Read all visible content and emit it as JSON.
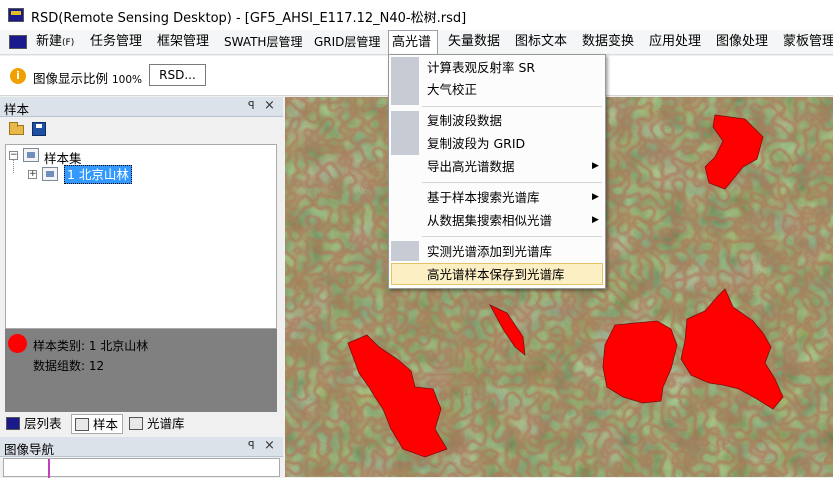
{
  "window": {
    "title": "RSD(Remote Sensing Desktop) - [GF5_AHSI_E117.12_N40-松树.rsd]"
  },
  "menubar": {
    "items": [
      {
        "label": "新建",
        "sub": "(F)"
      },
      {
        "label": "任务管理"
      },
      {
        "label": "框架管理"
      },
      {
        "label": "SWATH层管理"
      },
      {
        "label": "GRID层管理"
      },
      {
        "label": "高光谱"
      },
      {
        "label": "矢量数据"
      },
      {
        "label": "图标文本"
      },
      {
        "label": "数据变换"
      },
      {
        "label": "应用处理"
      },
      {
        "label": "图像处理"
      },
      {
        "label": "蒙板管理"
      }
    ],
    "active": "高光谱"
  },
  "toolbar": {
    "zoom_label": "图像显示比例",
    "zoom_value": "100%",
    "rsd_button": "RSD..."
  },
  "sample_panel": {
    "title": "样本",
    "pin": "ᵖ",
    "close": "×",
    "tree_root": "样本集",
    "tree_child": "1 北京山林",
    "info_category": "样本类别: 1 北京山林",
    "info_count": "数据组数: 12",
    "sample_color": "#ff0000"
  },
  "bottom_tabs": [
    {
      "label": "层列表"
    },
    {
      "label": "样本"
    },
    {
      "label": "光谱库"
    }
  ],
  "nav_panel": {
    "title": "图像导航"
  },
  "dropdown": {
    "items": [
      {
        "label": "计算表观反射率 SR",
        "submenu": false
      },
      {
        "label": "大气校正",
        "submenu": false
      },
      {
        "label": "复制波段数据",
        "submenu": false
      },
      {
        "label": "复制波段为 GRID",
        "submenu": false
      },
      {
        "label": "导出高光谱数据",
        "submenu": true
      },
      {
        "label": "基于样本搜索光谱库",
        "submenu": true
      },
      {
        "label": "从数据集搜索相似光谱",
        "submenu": true
      },
      {
        "label": "实测光谱添加到光谱库",
        "submenu": false
      },
      {
        "label": "高光谱样本保存到光谱库",
        "submenu": false
      }
    ],
    "highlighted": "高光谱样本保存到光谱库",
    "arrow": "▶"
  },
  "colors": {
    "sample_region": "#ff0000",
    "segment_edges": "#6b2d1a",
    "highlight": "#fdefc4"
  }
}
